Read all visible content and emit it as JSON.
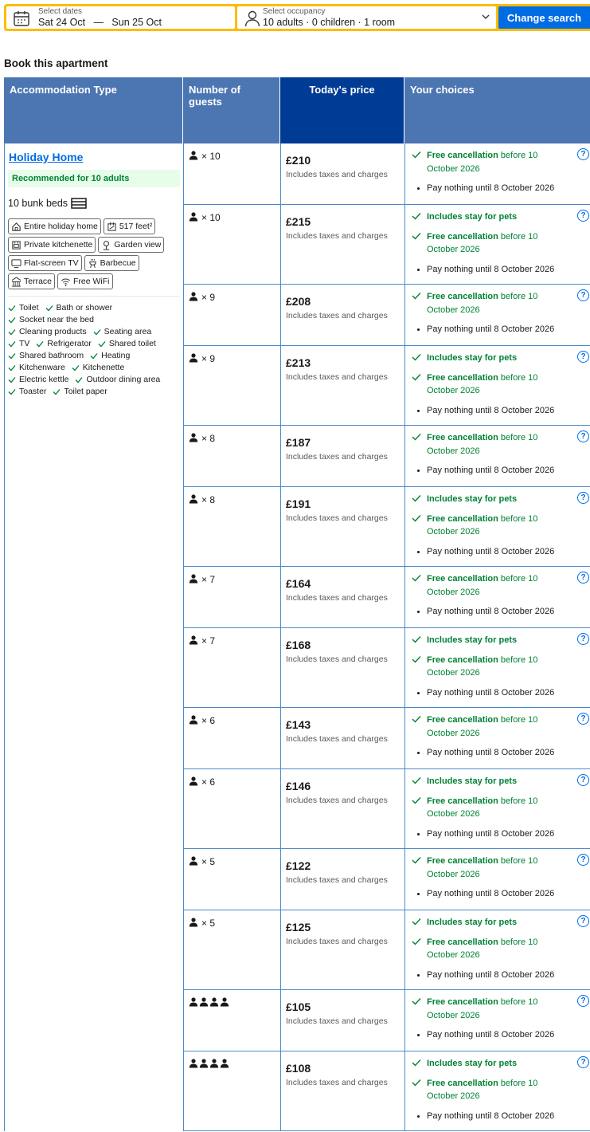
{
  "search": {
    "dates_label": "Select dates",
    "check_in": "Sat 24 Oct",
    "date_sep": "—",
    "check_out": "Sun 25 Oct",
    "occupancy_label": "Select occupancy",
    "occupancy_value": "10 adults · 0 children · 1 room",
    "change_button": "Change search"
  },
  "section_title": "Book this apartment",
  "table_headers": {
    "accommodation": "Accommodation Type",
    "guests": "Number of guests",
    "price": "Today's price",
    "choices": "Your choices"
  },
  "accommodation": {
    "name": "Holiday Home",
    "recommended": "Recommended for 10 adults",
    "beds": "10 bunk beds",
    "tags": [
      {
        "label": "Entire holiday home",
        "icon": "house-icon"
      },
      {
        "label": "517 feet²",
        "icon": "floor-size-icon"
      },
      {
        "label": "Private kitchenette",
        "icon": "kitchen-icon"
      },
      {
        "label": "Garden view",
        "icon": "garden-icon"
      },
      {
        "label": "Flat-screen TV",
        "icon": "tv-icon"
      },
      {
        "label": "Barbecue",
        "icon": "barbecue-icon"
      },
      {
        "label": "Terrace",
        "icon": "terrace-icon"
      },
      {
        "label": "Free WiFi",
        "icon": "wifi-icon"
      }
    ],
    "amenities": [
      "Toilet",
      "Bath or shower",
      "Socket near the bed",
      "Cleaning products",
      "Seating area",
      "TV",
      "Refrigerator",
      "Shared toilet",
      "Shared bathroom",
      "Heating",
      "Kitchenware",
      "Kitchenette",
      "Electric kettle",
      "Outdoor dining area",
      "Toaster",
      "Toilet paper"
    ]
  },
  "texts": {
    "taxes": "Includes taxes and charges",
    "pets": "Includes stay for pets",
    "free_cancel": "Free cancellation",
    "cancel_rest": " before 10 October 2026",
    "pay": "Pay nothing until 8 October 2026",
    "help": "?"
  },
  "rows": [
    {
      "guests": "× 10",
      "icons": 1,
      "price": "£210",
      "pets": false
    },
    {
      "guests": "× 10",
      "icons": 1,
      "price": "£215",
      "pets": true
    },
    {
      "guests": "× 9",
      "icons": 1,
      "price": "£208",
      "pets": false
    },
    {
      "guests": "× 9",
      "icons": 1,
      "price": "£213",
      "pets": true
    },
    {
      "guests": "× 8",
      "icons": 1,
      "price": "£187",
      "pets": false
    },
    {
      "guests": "× 8",
      "icons": 1,
      "price": "£191",
      "pets": true
    },
    {
      "guests": "× 7",
      "icons": 1,
      "price": "£164",
      "pets": false
    },
    {
      "guests": "× 7",
      "icons": 1,
      "price": "£168",
      "pets": true
    },
    {
      "guests": "× 6",
      "icons": 1,
      "price": "£143",
      "pets": false
    },
    {
      "guests": "× 6",
      "icons": 1,
      "price": "£146",
      "pets": true
    },
    {
      "guests": "× 5",
      "icons": 1,
      "price": "£122",
      "pets": false
    },
    {
      "guests": "× 5",
      "icons": 1,
      "price": "£125",
      "pets": true
    },
    {
      "guests": "",
      "icons": 4,
      "price": "£105",
      "pets": false
    },
    {
      "guests": "",
      "icons": 4,
      "price": "£108",
      "pets": true
    }
  ],
  "colors": {
    "accent": "#006ce4",
    "header_blue": "#4c76b2",
    "header_dark": "#003b95",
    "green": "#008234",
    "search_border": "#febb02"
  }
}
